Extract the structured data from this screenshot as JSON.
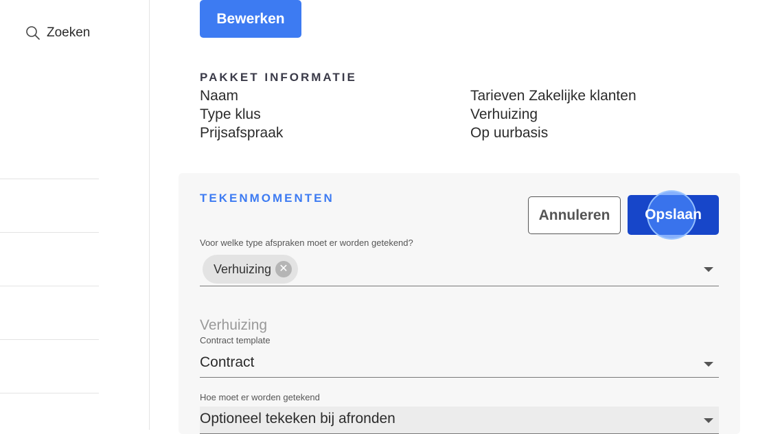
{
  "sidebar": {
    "search_label": "Zoeken"
  },
  "toolbar": {
    "edit_label": "Bewerken"
  },
  "pakket": {
    "title": "PAKKET INFORMATIE",
    "rows": [
      {
        "label": "Naam",
        "value": "Tarieven Zakelijke klanten"
      },
      {
        "label": "Type klus",
        "value": "Verhuizing"
      },
      {
        "label": "Prijsafspraak",
        "value": "Op uurbasis"
      }
    ]
  },
  "tekenmomenten": {
    "title": "TEKENMOMENTEN",
    "cancel_label": "Annuleren",
    "save_label": "Opslaan",
    "appointment_type_label": "Voor welke type afspraken moet er worden getekend?",
    "selected_chip": "Verhuizing",
    "group_heading": "Verhuizing",
    "contract_template_label": "Contract template",
    "contract_template_value": "Contract",
    "sign_method_label": "Hoe moet er worden getekend",
    "sign_method_value": "Optioneel tekeken bij afronden"
  },
  "colors": {
    "primary": "#3d7bf2",
    "save_button": "#1746c9",
    "section_accent": "#3d7bf2"
  }
}
